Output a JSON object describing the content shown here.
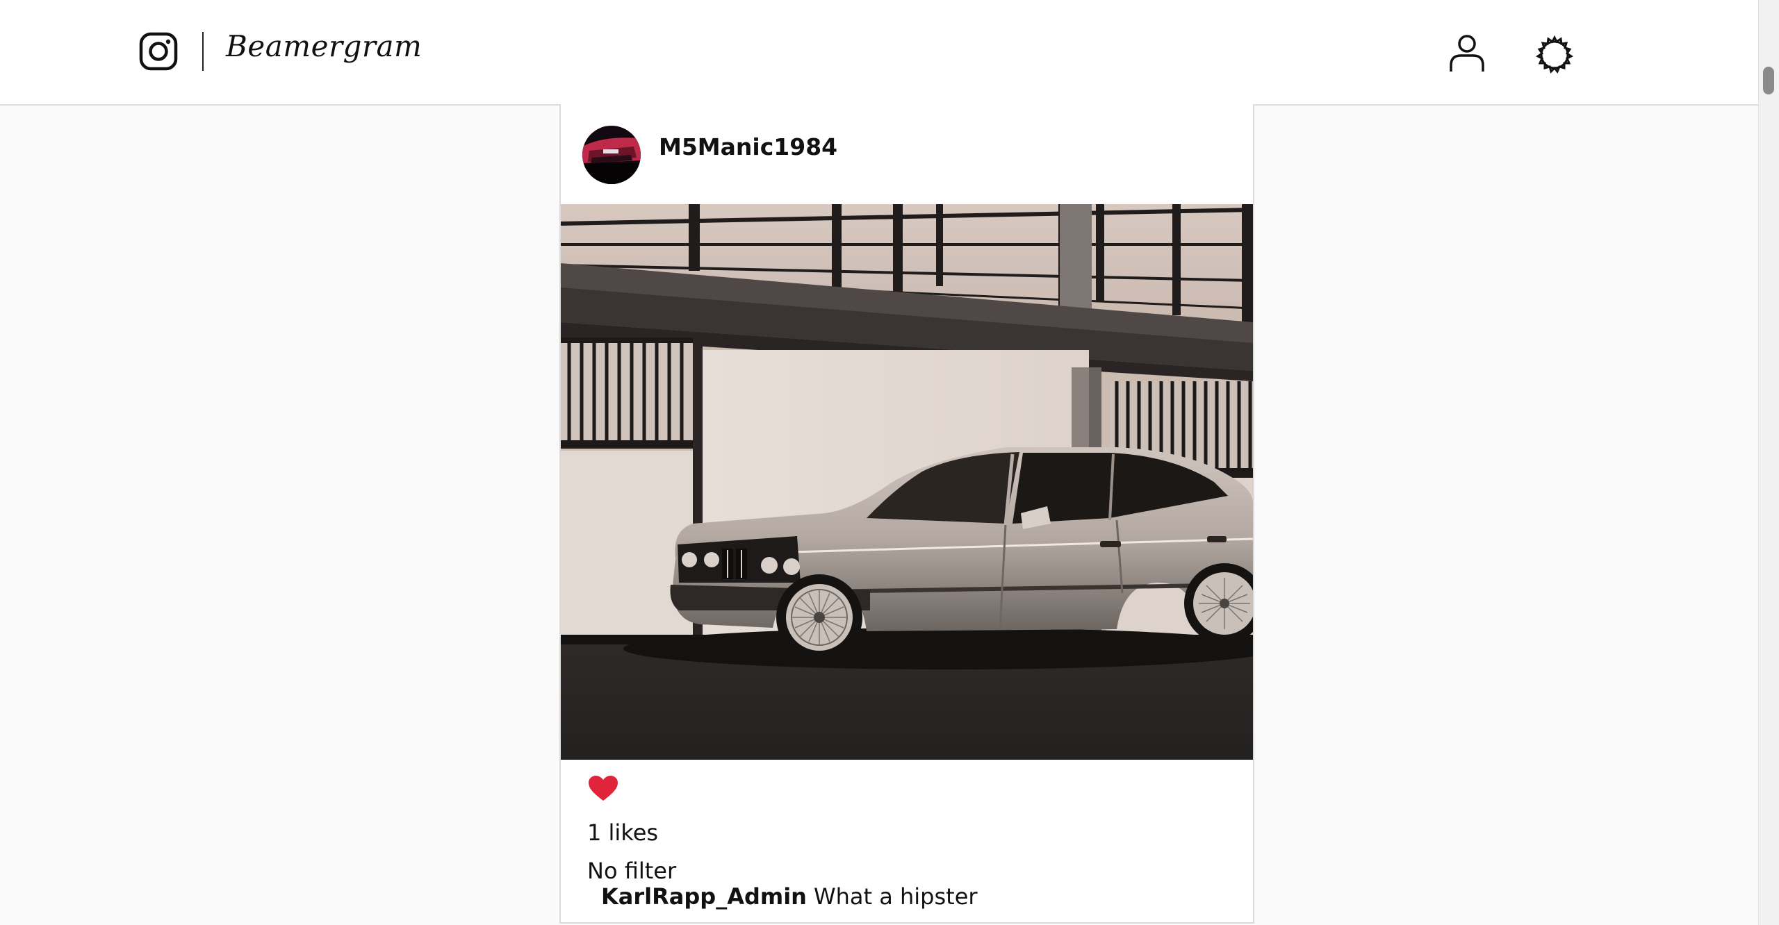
{
  "header": {
    "brand": "Beamergram",
    "logo_icon": "instagram-camera-icon",
    "profile_icon": "user-icon",
    "settings_icon": "gear-icon"
  },
  "post": {
    "username": "M5Manic1984",
    "avatar": "avatar-car-photo",
    "image_description_icon": "photo",
    "likes_text": "1 likes",
    "filter_text": "No filter",
    "comments": [
      {
        "user": "KarlRapp_Admin",
        "text": "What a hipster"
      }
    ],
    "like_icon": "heart-icon",
    "like_color": "#e0243a"
  },
  "colors": {
    "header_bg": "#ffffff",
    "page_bg": "#fafafa",
    "border": "#dbdbdb",
    "heart": "#e0243a"
  }
}
